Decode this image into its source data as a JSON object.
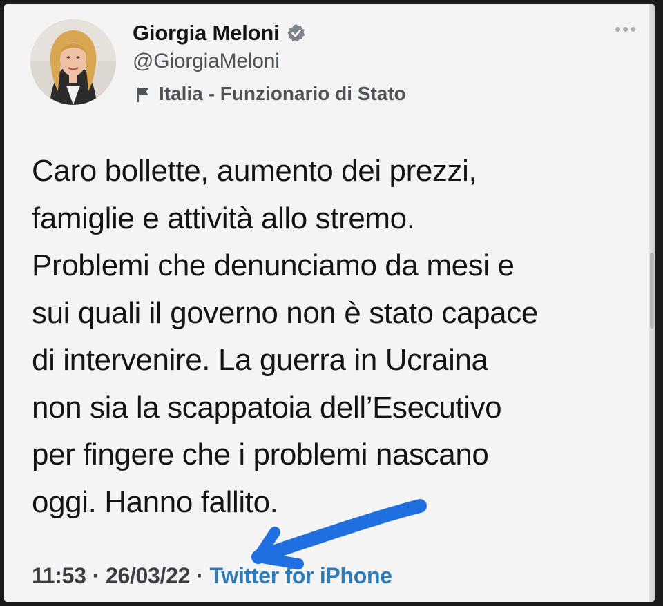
{
  "tweet": {
    "author": {
      "display_name": "Giorgia Meloni",
      "handle": "@GiorgiaMeloni",
      "label": "Italia - Funzionario di Stato",
      "verified": true,
      "avatar_icon": "profile-photo"
    },
    "more_icon": "more-options-icon",
    "text": "Caro bollette, aumento dei prezzi,\nfamiglie e attività allo stremo.\nProblemi che denunciamo da mesi e\nsui quali il governo non è stato capace\ndi intervenire. La guerra in Ucraina\nnon sia la scappatoia dell’Esecutivo\nper fingere che i problemi nascano\noggi. Hanno fallito.",
    "meta": {
      "time": "11:53",
      "separator": "·",
      "date": "26/03/22",
      "source": "Twitter for iPhone"
    }
  },
  "annotation": {
    "type": "hand-drawn arrow",
    "color": "#1f6fe0",
    "points_to": "source"
  },
  "colors": {
    "background": "#f4f4f4",
    "text": "#141414",
    "secondary_text": "#4e5358",
    "link": "#2f7cb9"
  }
}
